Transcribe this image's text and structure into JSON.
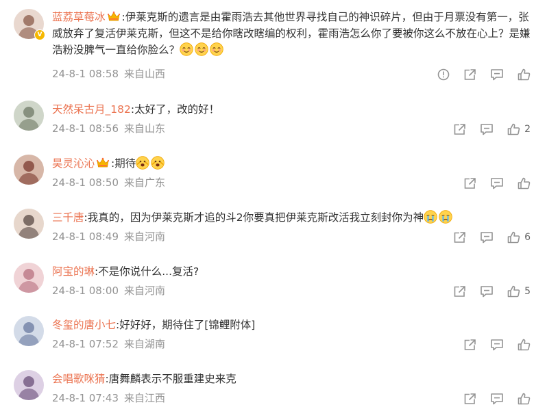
{
  "comments": [
    {
      "username": "蓝荔草莓冰",
      "text": "伊莱克斯的遗言是由霍雨浩去其他世界寻找自己的神识碎片，但由于月票没有第一，张威放弃了复活伊莱克斯，但这不是给你瞎改瞎编的权利，霍雨浩怎么你了要被你这么不放在心上？是嫌浩粉没脾气一直给你脸么？",
      "date": "24-8-1 08:58",
      "location": "来自山西",
      "likes": "",
      "has_report": true,
      "has_crown": true,
      "has_verified": true,
      "emoji": [
        "blush-emoji",
        "blush-emoji",
        "blush-emoji"
      ]
    },
    {
      "username": "天然呆古月_182",
      "text": "太好了，改的好！",
      "date": "24-8-1 08:56",
      "location": "来自山东",
      "likes": "2",
      "has_report": false,
      "has_crown": false,
      "has_verified": false,
      "emoji": []
    },
    {
      "username": "昊灵沁沁",
      "text": "期待",
      "date": "24-8-1 08:50",
      "location": "来自广东",
      "likes": "",
      "has_report": false,
      "has_crown": true,
      "has_verified": false,
      "emoji": [
        "excited-emoji",
        "excited-emoji"
      ]
    },
    {
      "username": "三千唐",
      "text": "我真的，因为伊莱克斯才追的斗2你要真把伊莱克斯改活我立刻封你为神",
      "date": "24-8-1 08:49",
      "location": "来自河南",
      "likes": "6",
      "has_report": false,
      "has_crown": false,
      "has_verified": false,
      "emoji": [
        "crying-emoji",
        "crying-emoji"
      ]
    },
    {
      "username": "阿宝的琳",
      "text": "不是你说什么...复活?",
      "date": "24-8-1 08:00",
      "location": "来自河南",
      "likes": "5",
      "has_report": false,
      "has_crown": false,
      "has_verified": false,
      "emoji": []
    },
    {
      "username": "冬玺的唐小七",
      "text": "好好好，期待住了[锦鲤附体]",
      "date": "24-8-1 07:52",
      "location": "来自湖南",
      "likes": "",
      "has_report": false,
      "has_crown": false,
      "has_verified": false,
      "emoji": []
    },
    {
      "username": "会唱歌咪猜",
      "text": "唐舞麟表示不服重建史来克",
      "date": "24-8-1 07:43",
      "location": "来自江西",
      "likes": "",
      "has_report": false,
      "has_crown": false,
      "has_verified": false,
      "emoji": []
    }
  ],
  "colors": {
    "username": "#eb7350",
    "body_text": "#333333",
    "meta_text": "#939393",
    "icon": "#939393",
    "verified_badge": "#f6b800"
  },
  "icons": {
    "report": "report-icon",
    "share": "share-icon",
    "comment": "comment-icon",
    "like": "like-icon",
    "crown": "crown-badge-icon"
  }
}
